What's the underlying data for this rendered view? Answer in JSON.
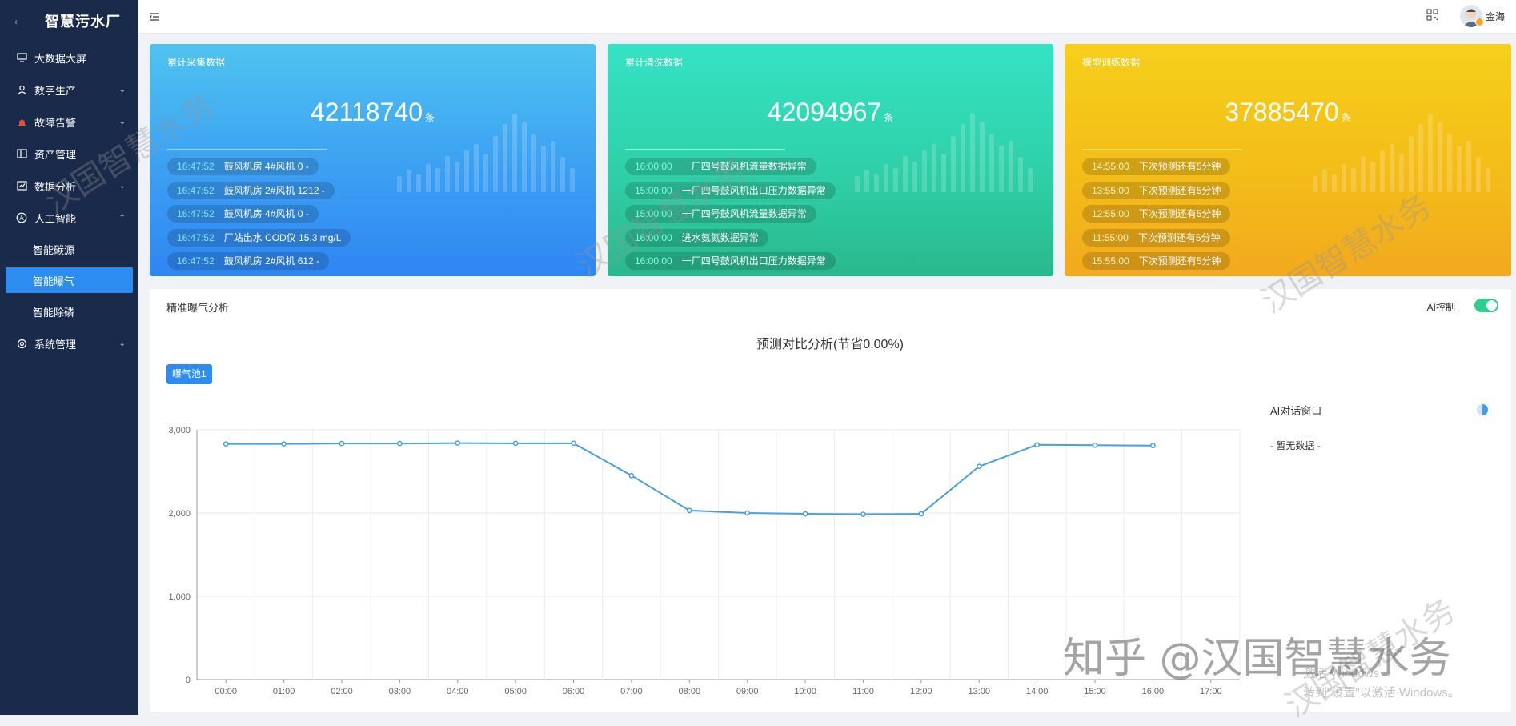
{
  "app": {
    "title": "智慧污水厂"
  },
  "sidebar": {
    "items": [
      {
        "label": "大数据大屏",
        "icon": "monitor-icon"
      },
      {
        "label": "数字生产",
        "icon": "user-icon"
      },
      {
        "label": "故障告警",
        "icon": "alarm-icon"
      },
      {
        "label": "资产管理",
        "icon": "book-icon"
      },
      {
        "label": "数据分析",
        "icon": "chart-icon"
      },
      {
        "label": "人工智能",
        "icon": "ai-icon"
      },
      {
        "label": "系统管理",
        "icon": "gear-icon"
      }
    ],
    "sub_items": [
      {
        "label": "智能碳源"
      },
      {
        "label": "智能曝气"
      },
      {
        "label": "智能除磷"
      }
    ]
  },
  "header": {
    "username": "金海"
  },
  "cards": [
    {
      "title": "累计采集数据",
      "value": "42118740",
      "unit": "条",
      "logs": [
        {
          "time": "16:47:52",
          "text": "鼓风机房 4#风机 0 -"
        },
        {
          "time": "16:47:52",
          "text": "鼓风机房 2#风机 1212 -"
        },
        {
          "time": "16:47:52",
          "text": "鼓风机房 4#风机 0 -"
        },
        {
          "time": "16:47:52",
          "text": "厂站出水 COD仪 15.3 mg/L"
        },
        {
          "time": "16:47:52",
          "text": "鼓风机房 2#风机 612 -"
        }
      ]
    },
    {
      "title": "累计清洗数据",
      "value": "42094967",
      "unit": "条",
      "logs": [
        {
          "time": "16:00:00",
          "text": "一厂四号鼓风机流量数据异常"
        },
        {
          "time": "15:00:00",
          "text": "一厂四号鼓风机出口压力数据异常"
        },
        {
          "time": "15:00:00",
          "text": "一厂四号鼓风机流量数据异常"
        },
        {
          "time": "16:00:00",
          "text": "进水氨氮数据异常"
        },
        {
          "time": "16:00:00",
          "text": "一厂四号鼓风机出口压力数据异常"
        }
      ]
    },
    {
      "title": "模型训练数据",
      "value": "37885470",
      "unit": "条",
      "logs": [
        {
          "time": "14:55:00",
          "text": "下次预测还有5分钟"
        },
        {
          "time": "13:55:00",
          "text": "下次预测还有5分钟"
        },
        {
          "time": "12:55:00",
          "text": "下次预测还有5分钟"
        },
        {
          "time": "11:55:00",
          "text": "下次预测还有5分钟"
        },
        {
          "time": "15:55:00",
          "text": "下次预测还有5分钟"
        }
      ]
    }
  ],
  "panel": {
    "title": "精准曝气分析",
    "ai_control_label": "AI控制",
    "ai_control_on": true,
    "pool_button": "曝气池1",
    "ai_window_title": "AI对话窗口",
    "ai_window_empty": "- 暂无数据 -"
  },
  "chart_data": {
    "type": "line",
    "title": "预测对比分析(节省0.00%)",
    "categories": [
      "00:00",
      "01:00",
      "02:00",
      "03:00",
      "04:00",
      "05:00",
      "06:00",
      "07:00",
      "08:00",
      "09:00",
      "10:00",
      "11:00",
      "12:00",
      "13:00",
      "14:00",
      "15:00",
      "16:00",
      "17:00"
    ],
    "series": [
      {
        "values": [
          2830,
          2830,
          2835,
          2835,
          2840,
          2838,
          2838,
          2450,
          2030,
          2000,
          1990,
          1985,
          1990,
          2560,
          2820,
          2815,
          2810,
          null
        ]
      }
    ],
    "yticks": [
      "0",
      "1,000",
      "2,000",
      "3,000"
    ],
    "ylim": [
      0,
      3000
    ],
    "grid": true,
    "color": "#4a9fe0"
  },
  "watermarks": [
    "汉国智慧水务",
    "汉国智慧水务",
    "汉国智慧水务",
    "汉国智慧水务"
  ],
  "zhihu": "知乎 @汉国智慧水务",
  "windows": {
    "line1": "激活 Windows",
    "line2": "转到\"设置\"以激活 Windows。"
  }
}
